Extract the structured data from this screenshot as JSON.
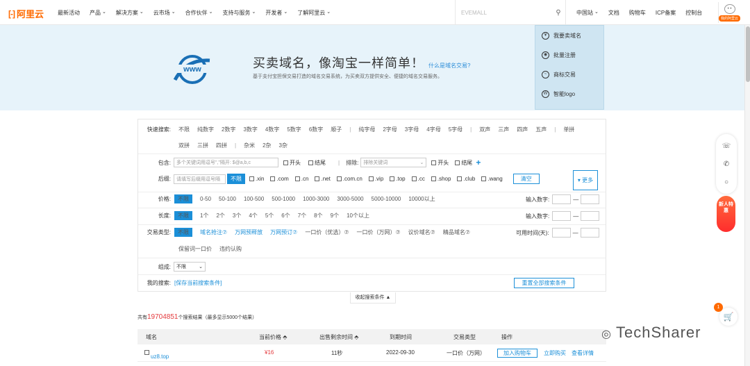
{
  "nav": {
    "logo": "阿里云",
    "logo_mark": "[-]",
    "items": [
      "最新活动",
      "产品",
      "解决方案",
      "云市场",
      "合作伙伴",
      "支持与服务",
      "开发者",
      "了解阿里云"
    ],
    "search_placeholder": "EVEMALL",
    "right": [
      "中国站",
      "文档",
      "购物车",
      "ICP备案",
      "控制台"
    ],
    "avatar_badge": "我的阿里云"
  },
  "banner": {
    "title": "买卖域名，像淘宝一样简单！",
    "link": "什么是域名交易?",
    "subtitle": "基于支付宝担保交易打造的域名交易系统，为买卖双方提供安全、便捷的域名交易服务。",
    "menu": [
      {
        "icon": "yen-icon",
        "glyph": "¥",
        "label": "我要卖域名"
      },
      {
        "icon": "user-icon",
        "glyph": "◉",
        "label": "批量注册"
      },
      {
        "icon": "trend-icon",
        "glyph": "~",
        "label": "商标交易"
      },
      {
        "icon": "w-icon",
        "glyph": "W",
        "label": "智能logo"
      }
    ]
  },
  "filters": {
    "quick_label": "快速搜索:",
    "quick_row1": [
      "不限",
      "纯数字",
      "2数字",
      "3数字",
      "4数字",
      "5数字",
      "6数字",
      "顺子",
      "|",
      "纯字母",
      "2字母",
      "3字母",
      "4字母",
      "5字母",
      "|",
      "双声",
      "三声",
      "四声",
      "五声",
      "|",
      "单拼"
    ],
    "quick_row2": [
      "双拼",
      "三拼",
      "四拼",
      "|",
      "杂米",
      "2杂",
      "3杂"
    ],
    "contain_label": "包含:",
    "contain_placeholder": "多个关键词用逗号\",\"隔开: $@a,b,c",
    "start": "开头",
    "end": "结尾",
    "exclude_label": "排除:",
    "exclude_placeholder": "排除关键词",
    "suffix_label": "后缀:",
    "suffix_placeholder": "请填写后缀用逗号隔",
    "suffix_all": "不限",
    "suffixes": [
      ".xin",
      ".com",
      ".cn",
      ".net",
      ".com.cn",
      ".vip",
      ".top",
      ".cc",
      ".shop",
      ".club",
      ".wang"
    ],
    "clear": "清空",
    "more": "▾ 更多",
    "price_label": "价格:",
    "price_opts": [
      "不限",
      "0-50",
      "50-100",
      "100-500",
      "500-1000",
      "1000-3000",
      "3000-5000",
      "5000-10000",
      "10000以上"
    ],
    "input_num": "输入数字:",
    "length_label": "长度:",
    "length_opts": [
      "不限",
      "1个",
      "2个",
      "3个",
      "4个",
      "5个",
      "6个",
      "7个",
      "8个",
      "9个",
      "10个以上"
    ],
    "trade_label": "交易类型:",
    "trade_opts": [
      "不限",
      "域名抢注⑦",
      "万网预释放",
      "万网预订⑦",
      "一口价（优选）⑦",
      "一口价（万网）⑦",
      "议价域名⑦",
      "精品域名⑦"
    ],
    "trade_row2": [
      "保留词一口价",
      "违约认购"
    ],
    "avail_time": "可用时间(天):",
    "compose_label": "组成:",
    "compose_value": "不限",
    "my_search_label": "我的搜索:",
    "save_search": "[保存当前搜索条件]",
    "reset_all": "重置全部搜索条件",
    "collapse": "收起搜索条件 ▲"
  },
  "results": {
    "prefix": "共有",
    "count": "19704851",
    "suffix": "个搜索结果（最多显示5000个结果）",
    "headers": [
      "域名",
      "当前价格 ⬘",
      "出售剩余时间 ⬘",
      "到期时间",
      "交易类型",
      "操作"
    ],
    "rows": [
      {
        "domain": "uz8.top",
        "price": "¥16",
        "remain": "11秒",
        "expire": "2022-09-30",
        "type": "一口价（万网）",
        "add_cart": "加入购物车",
        "buy": "立即购买",
        "detail": "查看详情"
      }
    ]
  },
  "side": {
    "newuser": "新人特惠",
    "cart_count": "1"
  },
  "watermark": "TechSharer"
}
